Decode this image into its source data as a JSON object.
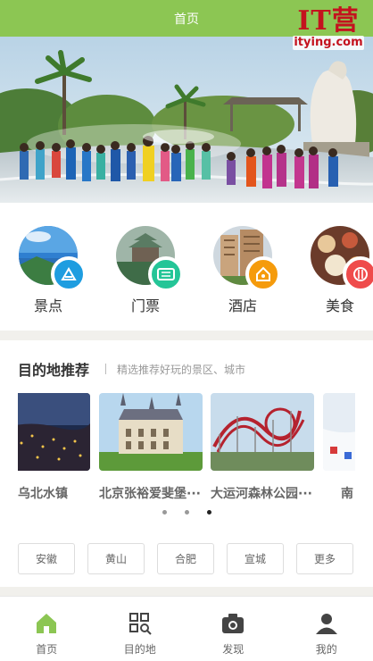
{
  "header": {
    "title": "首页"
  },
  "logo": {
    "main": "IT营",
    "sub": "itying.com"
  },
  "categories": [
    {
      "label": "景点",
      "icon": "scenic-icon",
      "color": "#1e9de0"
    },
    {
      "label": "门票",
      "icon": "ticket-icon",
      "color": "#24c597"
    },
    {
      "label": "酒店",
      "icon": "hotel-icon",
      "color": "#f59b0c"
    },
    {
      "label": "美食",
      "icon": "food-icon",
      "color": "#ef4b4b"
    }
  ],
  "recommend": {
    "title": "目的地推荐",
    "subtitle": "精选推荐好玩的景区、城市",
    "cards": [
      {
        "name": "乌北水镇"
      },
      {
        "name": "北京张裕爱斐堡···"
      },
      {
        "name": "大运河森林公园···"
      },
      {
        "name": "南"
      }
    ],
    "dots": 3,
    "active_dot": 2,
    "tags": [
      "安徽",
      "黄山",
      "合肥",
      "宣城",
      "更多"
    ]
  },
  "tabbar": [
    {
      "label": "首页",
      "icon": "home-icon",
      "active": true
    },
    {
      "label": "目的地",
      "icon": "qr-search-icon",
      "active": false
    },
    {
      "label": "发现",
      "icon": "camera-icon",
      "active": false
    },
    {
      "label": "我的",
      "icon": "user-icon",
      "active": false
    }
  ],
  "colors": {
    "accent": "#8cc653",
    "logo": "#c4121e"
  }
}
